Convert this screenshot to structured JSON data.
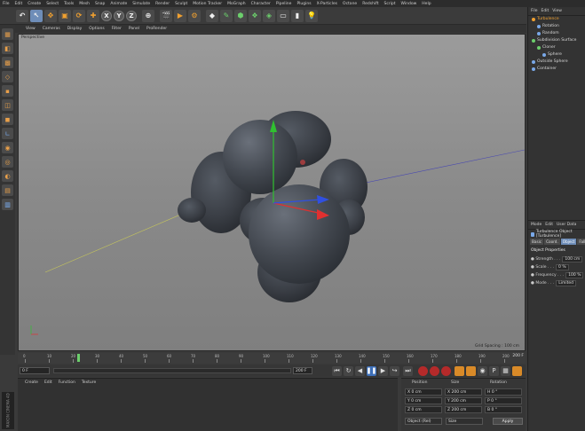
{
  "menu": [
    "File",
    "Edit",
    "Create",
    "Select",
    "Tools",
    "Mesh",
    "Snap",
    "Animate",
    "Simulate",
    "Render",
    "Sculpt",
    "Motion Tracker",
    "MoGraph",
    "Character",
    "Pipeline",
    "Plugins",
    "X-Particles",
    "Octane",
    "Redshift",
    "Script",
    "Window",
    "Help"
  ],
  "toolbar": {
    "axis_x": "X",
    "axis_y": "Y",
    "axis_z": "Z"
  },
  "viewport_menu": [
    "View",
    "Cameras",
    "Display",
    "Options",
    "Filter",
    "Panel",
    "ProRender"
  ],
  "viewport": {
    "label": "Perspective",
    "grid_spacing": "Grid Spacing : 100 cm"
  },
  "timeline": {
    "ticks": [
      "0",
      "10",
      "20",
      "30",
      "40",
      "50",
      "60",
      "70",
      "80",
      "90",
      "100",
      "110",
      "120",
      "130",
      "140",
      "150",
      "160",
      "170",
      "180",
      "190",
      "200"
    ],
    "current_frame_marker": 22,
    "end_frame": "200 F"
  },
  "transport": {
    "start_field": "0 F",
    "end_field": "200 F"
  },
  "tooltip": {
    "title": "Play Forwards",
    "line2": "Play Forwards",
    "line3": "[Shortcut F8]"
  },
  "material_menu": [
    "Create",
    "Edit",
    "Function",
    "Texture"
  ],
  "branding": "MAXON CINEMA 4D",
  "coordinates": {
    "headers": [
      "Position",
      "Size",
      "Rotation"
    ],
    "rows": [
      {
        "pos": "X  0 cm",
        "size": "X  200 cm",
        "rot": "H  0 °"
      },
      {
        "pos": "Y  0 cm",
        "size": "Y  200 cm",
        "rot": "P  0 °"
      },
      {
        "pos": "Z  0 cm",
        "size": "Z  200 cm",
        "rot": "B  0 °"
      }
    ],
    "mode": "Object (Rel)",
    "size_mode": "Size",
    "apply": "Apply"
  },
  "object_manager": {
    "menu": [
      "File",
      "Edit",
      "View"
    ],
    "items": [
      {
        "label": "Turbulence",
        "color": "#f0a030",
        "indent": 0,
        "selected": true
      },
      {
        "label": "Rotation",
        "color": "#79a8e8",
        "indent": 1,
        "selected": false
      },
      {
        "label": "Random",
        "color": "#79a8e8",
        "indent": 1,
        "selected": false
      },
      {
        "label": "Subdivision Surface",
        "color": "#6ccf6c",
        "indent": 0,
        "selected": false
      },
      {
        "label": "Cloner",
        "color": "#6ccf6c",
        "indent": 1,
        "selected": false
      },
      {
        "label": "Sphere",
        "color": "#79a8e8",
        "indent": 2,
        "selected": false
      },
      {
        "label": "Outside Sphere",
        "color": "#79a8e8",
        "indent": 0,
        "selected": false
      },
      {
        "label": "Container",
        "color": "#79a8e8",
        "indent": 0,
        "selected": false
      }
    ]
  },
  "attributes": {
    "menu": [
      "Mode",
      "Edit",
      "User Data"
    ],
    "title": "Turbulence Object [Turbulence]",
    "tabs": [
      "Basic",
      "Coord.",
      "Object",
      "Falloff"
    ],
    "active_tab": "Object",
    "section": "Object Properties",
    "properties": [
      {
        "label": "Strength",
        "value": "100 cm"
      },
      {
        "label": "Scale",
        "value": "0 %"
      },
      {
        "label": "Frequency",
        "value": "100 %"
      },
      {
        "label": "Mode",
        "value": "Limited"
      }
    ]
  },
  "colors": {
    "accent": "#f0a030",
    "selection_blue": "#3d6fb8",
    "axis_x": "#e03030",
    "axis_y": "#30c030",
    "axis_z": "#3050e0"
  }
}
